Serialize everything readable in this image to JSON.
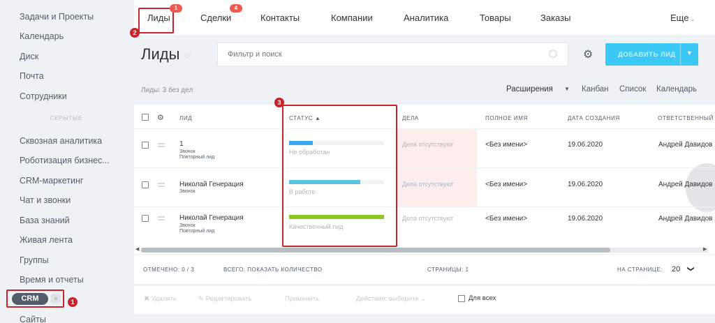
{
  "sidebar": {
    "items": [
      "Задачи и Проекты",
      "Календарь",
      "Диск",
      "Почта",
      "Сотрудники"
    ],
    "separator": "скрытые",
    "items2": [
      "Сквозная аналитика",
      "Роботизация бизнес...",
      "CRM-маркетинг",
      "Чат и звонки",
      "База знаний",
      "Живая лента",
      "Группы",
      "Время и отчеты"
    ],
    "crm_label": "CRM",
    "crm_close": "×",
    "crm_badge": "1",
    "after": "Сайты"
  },
  "nav": {
    "items": [
      "Лиды",
      "Сделки",
      "Контакты",
      "Компании",
      "Аналитика",
      "Товары",
      "Заказы"
    ],
    "more": "Еще",
    "leads_count": "1",
    "deals_count": "4",
    "marker": "2"
  },
  "header": {
    "title": "Лиды",
    "filter_placeholder": "Фильтр и поиск",
    "add_button": "Добавить лид",
    "add_arrow": "▼"
  },
  "toolbar": {
    "count": "Лиды: 3 без дел",
    "extensions": "Расширения",
    "views": [
      "Канбан",
      "Список",
      "Календарь"
    ]
  },
  "table": {
    "columns": [
      "Лид",
      "Статус",
      "Дела",
      "Полное имя",
      "Дата создания",
      "Ответственный"
    ],
    "status_sort": "▲",
    "marker": "3",
    "rows": [
      {
        "name": "1",
        "sub1": "Звонок",
        "sub2": "Повторный лид",
        "status": "Не обработан",
        "status_pct": 25,
        "status_color": "#39a8ef",
        "deal": "Дела отсутствуют",
        "full_name": "<Без имени>",
        "date": "19.06.2020",
        "resp": "Андрей Давидов"
      },
      {
        "name": "Николай Генерация",
        "sub1": "Звонок",
        "sub2": "",
        "status": "В работе",
        "status_pct": 75,
        "status_color": "#55c4e0",
        "deal": "Дела отсутствуют",
        "full_name": "<Без имени>",
        "date": "19.06.2020",
        "resp": "Андрей Давидов"
      },
      {
        "name": "Николай Генерация",
        "sub1": "Звонок",
        "sub2": "Повторный лид",
        "status": "Качественный лид",
        "status_pct": 100,
        "status_color": "#8fc621",
        "deal": "Дела отсутствуют",
        "full_name": "<Без имени>",
        "date": "19.06.2020",
        "resp": "Андрей Давидов"
      }
    ]
  },
  "footer": {
    "marked_label": "Отмечено:",
    "marked_value": "0 / 3",
    "total": "Всего: показать количество",
    "pages": "Страницы: 1",
    "per_page": "На странице:",
    "per_page_value": "20",
    "caret": "❯"
  },
  "actions": {
    "items": [
      "Удалить",
      "Редактировать",
      "Применить",
      "Действия: выберите"
    ],
    "for_all": "Для всех"
  }
}
